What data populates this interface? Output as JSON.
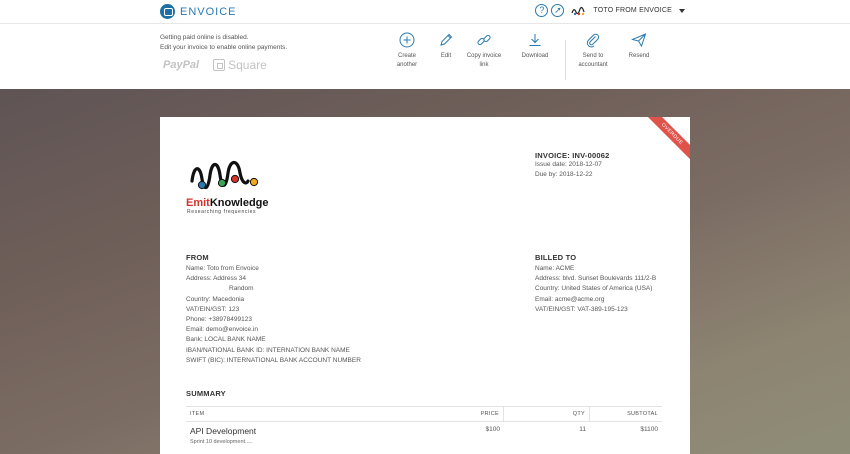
{
  "app": {
    "brand": "ENVOICE",
    "help_icon": "question-circle-icon",
    "compass_icon": "compass-icon",
    "user_name": "TOTO FROM ENVOICE"
  },
  "notice": {
    "line1": "Getting paid online is disabled.",
    "line2": "Edit your invoice to enable online payments."
  },
  "payment_logos": {
    "paypal": "PayPal",
    "square": "Square"
  },
  "actions": [
    {
      "label_1": "Create",
      "label_2": "another",
      "icon": "plus-circle-icon"
    },
    {
      "label_1": "Edit",
      "label_2": "",
      "icon": "pencil-icon"
    },
    {
      "label_1": "Copy invoice",
      "label_2": "link",
      "icon": "link-icon"
    },
    {
      "label_1": "Download",
      "label_2": "",
      "icon": "download-icon"
    },
    {
      "label_1": "Send to",
      "label_2": "accountant",
      "icon": "paperclip-icon"
    },
    {
      "label_1": "Resend",
      "label_2": "",
      "icon": "paper-plane-icon"
    }
  ],
  "invoice": {
    "ribbon": "OVERDUE",
    "company": {
      "word_1": "Emit",
      "word_2": "Knowledge",
      "tagline": "Researching frequencies"
    },
    "number": "INVOICE: INV-00062",
    "issue_date": "Issue date: 2018-12-07",
    "due_by": "Due by: 2018-12-22",
    "from": {
      "title": "FROM",
      "name": "Name: Toto from Envoice",
      "address_1": "Address: Address 34",
      "address_2": "Random",
      "country": "Country: Macedonia",
      "vat": "VAT/EIN/GST: 123",
      "phone": "Phone: +38978499123",
      "email": "Email: demo@envoice.in",
      "bank": "Bank: LOCAL BANK NAME",
      "iban": "IBAN/NATIONAL BANK ID: INTERNATION BANK NAME",
      "swift": "SWIFT (BIC): INTERNATIONAL BANK ACCOUNT NUMBER"
    },
    "billed_to": {
      "title": "BILLED TO",
      "name": "Name: ACME",
      "address": "Address: blvd. Sunset Boulevards 111/2-B",
      "country": "Country: United States of America (USA)",
      "email": "Email: acme@acme.org",
      "vat": "VAT/EIN/GST: VAT-389-195-123"
    },
    "summary": {
      "title": "SUMMARY",
      "headers": {
        "item": "ITEM",
        "price": "PRICE",
        "qty": "QTY",
        "subtotal": "SUBTOTAL"
      },
      "rows": [
        {
          "name": "API Development",
          "description": "Sprint 10 development.....",
          "price": "$100",
          "qty": "11",
          "subtotal": "$1100"
        }
      ]
    }
  },
  "colors": {
    "accent": "#2a7ab0",
    "ribbon": "#e0534a"
  }
}
